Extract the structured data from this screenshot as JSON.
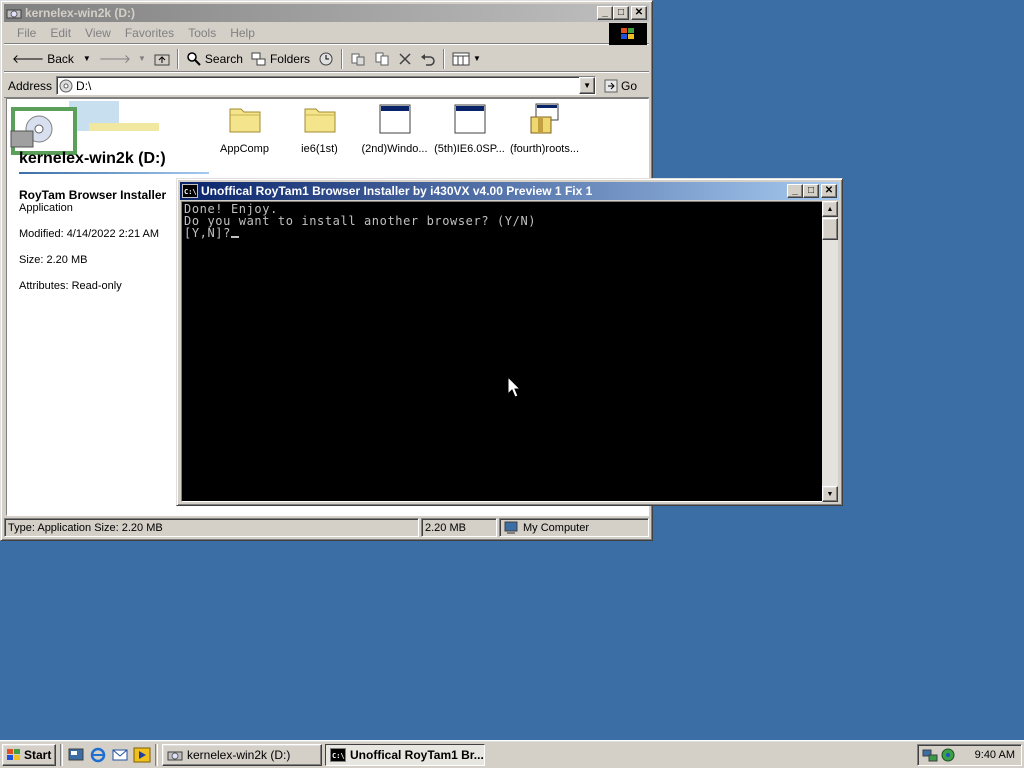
{
  "explorer": {
    "title": "kernelex-win2k (D:)",
    "menu": [
      "File",
      "Edit",
      "View",
      "Favorites",
      "Tools",
      "Help"
    ],
    "toolbar": {
      "back": "Back",
      "search": "Search",
      "folders": "Folders"
    },
    "address": {
      "label": "Address",
      "value": "D:\\",
      "go": "Go"
    },
    "drive_title": "kernelex-win2k (D:)",
    "selection": {
      "name": "RoyTam Browser Installer",
      "type": "Application",
      "modified": "Modified: 4/14/2022 2:21 AM",
      "size": "Size: 2.20 MB",
      "attributes": "Attributes: Read-only"
    },
    "files": [
      {
        "label": "AppComp",
        "icon": "folder-icon"
      },
      {
        "label": "ie6(1st)",
        "icon": "folder-icon"
      },
      {
        "label": "(2nd)Windo...",
        "icon": "window-app-icon"
      },
      {
        "label": "(5th)IE6.0SP...",
        "icon": "window-app-icon"
      },
      {
        "label": "(fourth)roots...",
        "icon": "installer-icon"
      }
    ],
    "status": {
      "info": "Type: Application Size: 2.20 MB",
      "size": "2.20 MB",
      "zone": "My Computer"
    }
  },
  "console": {
    "title": "Unoffical RoyTam1 Browser Installer by i430VX v4.00 Preview 1 Fix 1",
    "lines": [
      "Done! Enjoy.",
      "Do you want to install another browser? (Y/N)",
      "[Y,N]?"
    ]
  },
  "taskbar": {
    "start": "Start",
    "tasks": [
      {
        "label": "kernelex-win2k (D:)",
        "active": false
      },
      {
        "label": "Unoffical RoyTam1 Br...",
        "active": true
      }
    ],
    "clock": "9:40 AM"
  },
  "colors": {
    "desktop": "#3a6ea5",
    "active_title": "#0a246a",
    "face": "#d4d0c8"
  }
}
